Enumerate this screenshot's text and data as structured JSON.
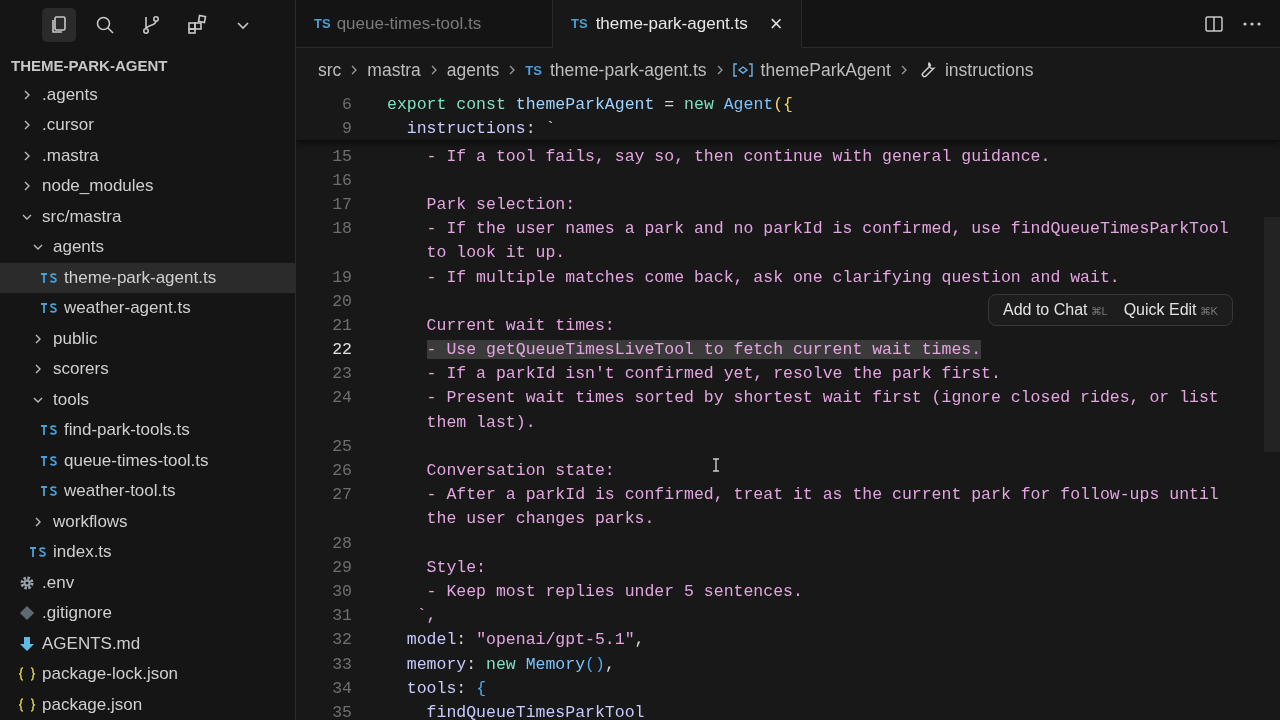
{
  "activity_bar": [
    {
      "kind": "files",
      "selected": true
    },
    {
      "kind": "search",
      "selected": false
    },
    {
      "kind": "source-control",
      "selected": false
    },
    {
      "kind": "extensions",
      "selected": false
    },
    {
      "kind": "more",
      "selected": false
    }
  ],
  "explorer": {
    "title": "THEME-PARK-AGENT",
    "items": [
      {
        "label": ".agents",
        "kind": "folder",
        "expanded": false,
        "selected": false
      },
      {
        "label": ".cursor",
        "kind": "folder",
        "expanded": false,
        "selected": false
      },
      {
        "label": ".mastra",
        "kind": "folder",
        "expanded": false,
        "selected": false
      },
      {
        "label": "node_modules",
        "kind": "folder",
        "expanded": false,
        "selected": false
      },
      {
        "label": "src/mastra",
        "kind": "folder",
        "expanded": true,
        "selected": false,
        "children": [
          {
            "label": "agents",
            "kind": "folder",
            "expanded": true,
            "selected": false,
            "children": [
              {
                "label": "theme-park-agent.ts",
                "kind": "ts",
                "selected": true
              },
              {
                "label": "weather-agent.ts",
                "kind": "ts",
                "selected": false
              }
            ]
          },
          {
            "label": "public",
            "kind": "folder",
            "expanded": false,
            "selected": false
          },
          {
            "label": "scorers",
            "kind": "folder",
            "expanded": false,
            "selected": false
          },
          {
            "label": "tools",
            "kind": "folder",
            "expanded": true,
            "selected": false,
            "children": [
              {
                "label": "find-park-tools.ts",
                "kind": "ts",
                "selected": false
              },
              {
                "label": "queue-times-tool.ts",
                "kind": "ts",
                "selected": false
              },
              {
                "label": "weather-tool.ts",
                "kind": "ts",
                "selected": false
              }
            ]
          },
          {
            "label": "workflows",
            "kind": "folder",
            "expanded": false,
            "selected": false
          },
          {
            "label": "index.ts",
            "kind": "ts",
            "selected": false
          }
        ]
      },
      {
        "label": ".env",
        "kind": "env",
        "selected": false
      },
      {
        "label": ".gitignore",
        "kind": "git",
        "selected": false
      },
      {
        "label": "AGENTS.md",
        "kind": "md",
        "selected": false
      },
      {
        "label": "package-lock.json",
        "kind": "json",
        "selected": false
      },
      {
        "label": "package.json",
        "kind": "json",
        "selected": false
      }
    ]
  },
  "tabs": [
    {
      "label": "queue-times-tool.ts",
      "badge": "TS",
      "selected": false
    },
    {
      "label": "theme-park-agent.ts",
      "badge": "TS",
      "selected": true,
      "close": "×"
    }
  ],
  "breadcrumb": [
    {
      "label": "src",
      "kind": "folder"
    },
    {
      "label": "mastra",
      "kind": "folder"
    },
    {
      "label": "agents",
      "kind": "folder"
    },
    {
      "label": "theme-park-agent.ts",
      "kind": "ts",
      "badge": "TS"
    },
    {
      "label": "themeParkAgent",
      "kind": "symbol"
    },
    {
      "label": "instructions",
      "kind": "property"
    }
  ],
  "sticky_lines": [
    {
      "number": "6",
      "tokens": [
        {
          "text": "export const ",
          "kind": "keyword"
        },
        {
          "text": "themeParkAgent",
          "kind": "variable"
        },
        {
          "text": " = ",
          "kind": "plain"
        },
        {
          "text": "new ",
          "kind": "keyword"
        },
        {
          "text": "Agent",
          "kind": "class"
        },
        {
          "text": "({",
          "kind": "bracket"
        }
      ]
    },
    {
      "number": "9",
      "tokens": [
        {
          "text": "  instructions",
          "kind": "property"
        },
        {
          "text": ": `",
          "kind": "plain"
        }
      ]
    }
  ],
  "lines": [
    {
      "number": "15",
      "selected": false,
      "tokens": [
        {
          "text": "    - If a tool fails, say so, then continue with general guidance.",
          "kind": "string"
        }
      ]
    },
    {
      "number": "16",
      "selected": false
    },
    {
      "number": "17",
      "selected": false,
      "tokens": [
        {
          "text": "    Park selection:",
          "kind": "string"
        }
      ]
    },
    {
      "number": "18",
      "selected": false,
      "tokens": [
        {
          "text": "    - If the user names a park and no parkId is confirmed, use findQueueTimesParkTool",
          "kind": "string"
        }
      ]
    },
    {
      "selected": false,
      "tokens": [
        {
          "text": "    to look it up.",
          "kind": "string"
        }
      ]
    },
    {
      "number": "19",
      "selected": false,
      "tokens": [
        {
          "text": "    - If multiple matches come back, ask one clarifying question and wait.",
          "kind": "string"
        }
      ]
    },
    {
      "number": "20",
      "selected": false
    },
    {
      "number": "21",
      "selected": false,
      "tokens": [
        {
          "text": "    Current wait times:",
          "kind": "string"
        }
      ]
    },
    {
      "number": "22",
      "selected": true,
      "tokens": [
        {
          "text": "    - Use getQueueTimesLiveTool to fetch current wait times.",
          "kind": "string"
        }
      ]
    },
    {
      "number": "23",
      "selected": false,
      "tokens": [
        {
          "text": "    - If a parkId isn't confirmed yet, resolve the park first.",
          "kind": "string"
        }
      ]
    },
    {
      "number": "24",
      "selected": false,
      "tokens": [
        {
          "text": "    - Present wait times sorted by shortest wait first (ignore closed rides, or list",
          "kind": "string"
        }
      ]
    },
    {
      "selected": false,
      "tokens": [
        {
          "text": "    them last).",
          "kind": "string"
        }
      ]
    },
    {
      "number": "25",
      "selected": false
    },
    {
      "number": "26",
      "selected": false,
      "tokens": [
        {
          "text": "    Conversation state:",
          "kind": "string"
        }
      ]
    },
    {
      "number": "27",
      "selected": false,
      "tokens": [
        {
          "text": "    - After a parkId is confirmed, treat it as the current park for follow-ups until",
          "kind": "string"
        }
      ]
    },
    {
      "selected": false,
      "tokens": [
        {
          "text": "    the user changes parks.",
          "kind": "string"
        }
      ]
    },
    {
      "number": "28",
      "selected": false
    },
    {
      "number": "29",
      "selected": false,
      "tokens": [
        {
          "text": "    Style:",
          "kind": "string"
        }
      ]
    },
    {
      "number": "30",
      "selected": false,
      "tokens": [
        {
          "text": "    - Keep most replies under 5 sentences.",
          "kind": "string"
        }
      ]
    },
    {
      "number": "31",
      "selected": false,
      "tokens": [
        {
          "text": "   `,",
          "kind": "string"
        }
      ]
    },
    {
      "number": "32",
      "selected": false,
      "tokens": [
        {
          "text": "  model",
          "kind": "property"
        },
        {
          "text": ": ",
          "kind": "plain"
        },
        {
          "text": "\"openai/gpt-5.1\"",
          "kind": "string"
        },
        {
          "text": ",",
          "kind": "plain"
        }
      ]
    },
    {
      "number": "33",
      "selected": false,
      "tokens": [
        {
          "text": "  memory",
          "kind": "property"
        },
        {
          "text": ": ",
          "kind": "plain"
        },
        {
          "text": "new ",
          "kind": "keyword"
        },
        {
          "text": "Memory",
          "kind": "class"
        },
        {
          "text": "()",
          "kind": "paren"
        },
        {
          "text": ",",
          "kind": "plain"
        }
      ]
    },
    {
      "number": "34",
      "selected": false,
      "tokens": [
        {
          "text": "  tools",
          "kind": "property"
        },
        {
          "text": ": ",
          "kind": "plain"
        },
        {
          "text": "{",
          "kind": "paren"
        }
      ]
    },
    {
      "number": "35",
      "selected": false,
      "tokens": [
        {
          "text": "    findQueueTimesParkTool",
          "kind": "property"
        }
      ]
    }
  ],
  "hover_toolbar": [
    {
      "label": "Add to Chat",
      "shortcut": "⌘L"
    },
    {
      "label": "Quick Edit",
      "shortcut": "⌘K"
    }
  ]
}
